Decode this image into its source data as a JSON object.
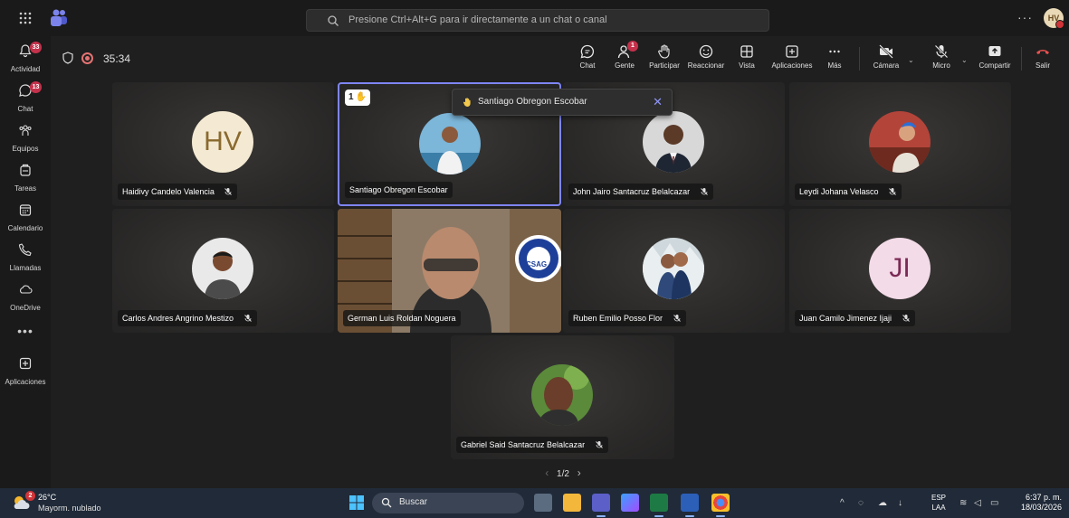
{
  "search": {
    "placeholder": "Presione Ctrl+Alt+G para ir directamente a un chat o canal"
  },
  "user": {
    "initials": "HV"
  },
  "rail": {
    "items": [
      {
        "label": "Actividad",
        "badge": "33"
      },
      {
        "label": "Chat",
        "badge": "13"
      },
      {
        "label": "Equipos",
        "badge": ""
      },
      {
        "label": "Tareas",
        "badge": ""
      },
      {
        "label": "Calendario",
        "badge": ""
      },
      {
        "label": "Llamadas",
        "badge": ""
      },
      {
        "label": "OneDrive",
        "badge": ""
      },
      {
        "label": "Aplicaciones",
        "badge": ""
      }
    ],
    "more": "•••"
  },
  "meeting": {
    "timer": "35:34",
    "controls": {
      "chat": "Chat",
      "people": "Gente",
      "people_badge": "1",
      "raise": "Participar",
      "react": "Reaccionar",
      "view": "Vista",
      "apps": "Aplicaciones",
      "more": "Más",
      "camera": "Cámara",
      "mic": "Micro",
      "share": "Compartir",
      "leave": "Salir"
    },
    "raised_hand_popup": {
      "name": "Santiago Obregon Escobar"
    },
    "raised_hand_order": "1",
    "participants": [
      {
        "name": "Haidivy Candelo Valencia",
        "initials": "HV",
        "muted": true
      },
      {
        "name": "Santiago Obregon Escobar",
        "initials": "",
        "muted": false
      },
      {
        "name": "John Jairo Santacruz Belalcazar",
        "initials": "",
        "muted": true
      },
      {
        "name": "Leydi Johana Velasco",
        "initials": "",
        "muted": true
      },
      {
        "name": "Carlos Andres Angrino Mestizo",
        "initials": "",
        "muted": true
      },
      {
        "name": "German Luis Roldan Noguera",
        "initials": "",
        "muted": false
      },
      {
        "name": "Ruben Emilio Posso Flor",
        "initials": "",
        "muted": true
      },
      {
        "name": "Juan Camilo Jimenez Ijaji",
        "initials": "JI",
        "muted": true
      },
      {
        "name": "Gabriel Said Santacruz Belalcazar",
        "initials": "",
        "muted": true
      }
    ],
    "logo_text": "CSAG",
    "pager": "1/2"
  },
  "taskbar": {
    "weather_temp": "26°C",
    "weather_desc": "Mayorm. nublado",
    "weather_badge": "2",
    "search": "Buscar",
    "lang_1": "ESP",
    "lang_2": "LAA",
    "time": "6:37 p. m.",
    "date": "18/03/2026"
  }
}
